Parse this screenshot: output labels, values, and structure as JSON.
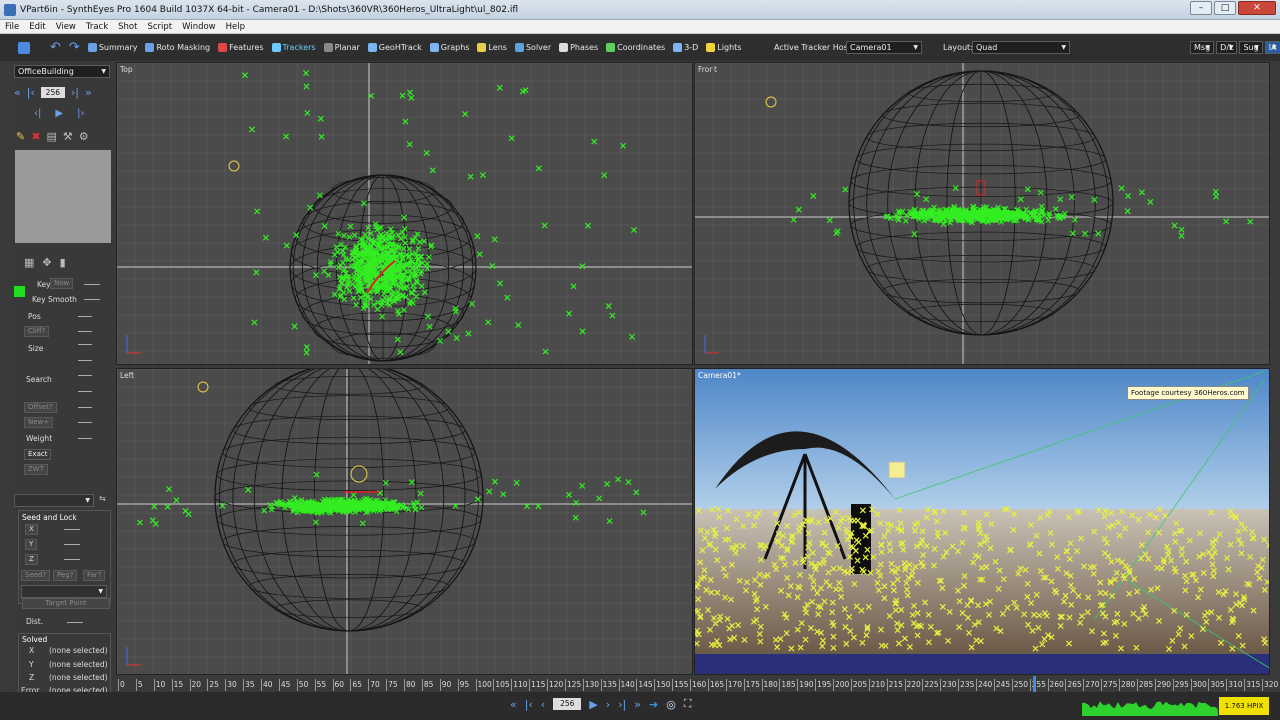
{
  "window": {
    "title": "VPart6in - SynthEyes Pro 1604 Build 1037X 64-bit - Camera01 - D:\\Shots\\360VR\\360Heros_UltraLight\\ul_802.ifl"
  },
  "menu": [
    "File",
    "Edit",
    "View",
    "Track",
    "Shot",
    "Script",
    "Window",
    "Help"
  ],
  "toolbar": {
    "rooms": [
      {
        "label": "Summary",
        "icon": "summary-icon",
        "color": "#6aa0e8"
      },
      {
        "label": "Roto Masking",
        "icon": "roto-icon",
        "color": "#6aa0e8"
      },
      {
        "label": "Features",
        "icon": "features-icon",
        "color": "#e04848"
      },
      {
        "label": "Trackers",
        "icon": "trackers-icon",
        "color": "#6ecbff",
        "active": true
      },
      {
        "label": "Planar",
        "icon": "planar-icon",
        "color": "#888888"
      },
      {
        "label": "GeoHTrack",
        "icon": "geohtrack-icon",
        "color": "#7bb6f0"
      },
      {
        "label": "Graphs",
        "icon": "graphs-icon",
        "color": "#7bb6f0"
      },
      {
        "label": "Lens",
        "icon": "lens-icon",
        "color": "#e6d04a"
      },
      {
        "label": "Solver",
        "icon": "solver-icon",
        "color": "#5da2e0"
      },
      {
        "label": "Phases",
        "icon": "phases-icon",
        "color": "#dddddd"
      },
      {
        "label": "Coordinates",
        "icon": "coordinates-icon",
        "color": "#5fd05f"
      },
      {
        "label": "3-D",
        "icon": "3d-icon",
        "color": "#7bb6f0"
      },
      {
        "label": "Lights",
        "icon": "lights-icon",
        "color": "#f0d23a"
      }
    ],
    "active_tracker_host_label": "Active Tracker Host:",
    "active_tracker_host": "Camera01",
    "layout_label": "Layout:",
    "layout": "Quad",
    "right_buttons": [
      "Msg",
      "D/L",
      "Sug",
      "IA"
    ]
  },
  "sidebar": {
    "object": "OfficeBuilding",
    "frame": "256",
    "key": "Key",
    "key_now": "Now",
    "key_smooth": "Key Smooth",
    "pos": "Pos",
    "cliff": "Cliff?",
    "size": "Size",
    "search": "Search",
    "offset": "Offset?",
    "new": "New+",
    "weight": "Weight",
    "exact": "Exact",
    "zwt": "ZWT",
    "seed_lock": "Seed and Lock",
    "x": "X",
    "y": "Y",
    "z": "Z",
    "seed": "Seed?",
    "peg": "Peg?",
    "far": "Far?",
    "target_point": "Target Point",
    "dist": "Dist.",
    "solved": "Solved",
    "solved_x": "(none selected)",
    "solved_y": "(none selected)",
    "solved_z": "(none selected)",
    "error": "Error",
    "error_val": "(none selected)"
  },
  "viewports": {
    "top": "Top",
    "front": "Front",
    "left": "Left",
    "camera": "Camera01*",
    "watermark": "Footage courtesy 360Heros.com"
  },
  "timeline": {
    "ticks": [
      "0",
      "5",
      "10",
      "15",
      "20",
      "25",
      "30",
      "35",
      "40",
      "45",
      "50",
      "55",
      "60",
      "65",
      "70",
      "75",
      "80",
      "85",
      "90",
      "95",
      "100",
      "105",
      "110",
      "115",
      "120",
      "125",
      "130",
      "135",
      "140",
      "145",
      "150",
      "155",
      "160",
      "165",
      "170",
      "175",
      "180",
      "185",
      "190",
      "195",
      "200",
      "205",
      "210",
      "215",
      "220",
      "225",
      "230",
      "235",
      "240",
      "245",
      "250",
      "255",
      "260",
      "265",
      "270",
      "275",
      "280",
      "285",
      "290",
      "295",
      "300",
      "305",
      "310",
      "315",
      "320"
    ],
    "current": 0.795
  },
  "playback": {
    "frame": "256",
    "hpix": "1.763 HPIX"
  },
  "colors": {
    "tracker": "#33ee22",
    "tracker_cam": "#e8f040",
    "grid": "#5a5a5a",
    "sphere": "#111111"
  }
}
